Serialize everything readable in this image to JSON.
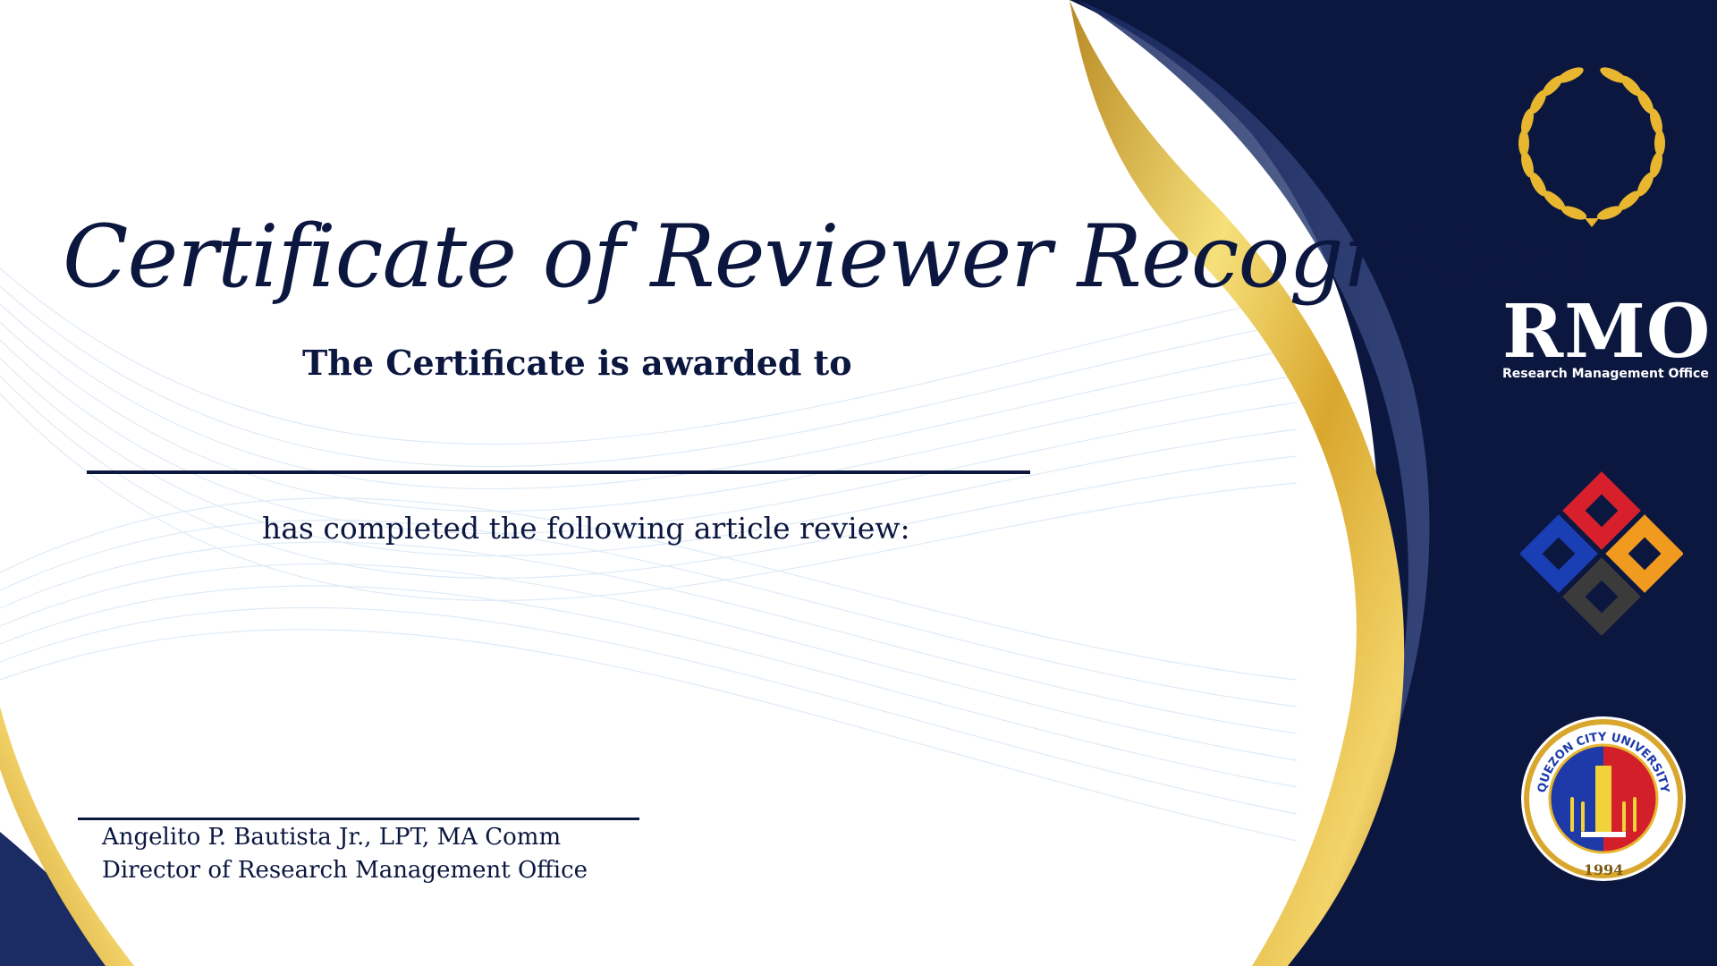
{
  "certificate": {
    "title": "Certificate of Reviewer Recognition",
    "awarded_text": "The Certificate is awarded to",
    "completed_text": "has completed the following article review:"
  },
  "signatory": {
    "name": "Angelito P. Bautista Jr., LPT, MA Comm",
    "role": "Director of Research Management Office"
  },
  "office": {
    "acronym": "RMO",
    "name": "Research Management Office"
  },
  "seal": {
    "university": "QUEZON CITY UNIVERSITY",
    "year": "1994"
  },
  "icons": [
    "laurel-wreath-icon",
    "puzzle-logo-icon",
    "university-seal-icon"
  ],
  "colors": {
    "navy": "#0c1740",
    "gold": "#d9a72e",
    "gold_light": "#f6e07a",
    "white": "#ffffff",
    "seal_blue": "#1d3aa8",
    "seal_red": "#d21f2a"
  }
}
